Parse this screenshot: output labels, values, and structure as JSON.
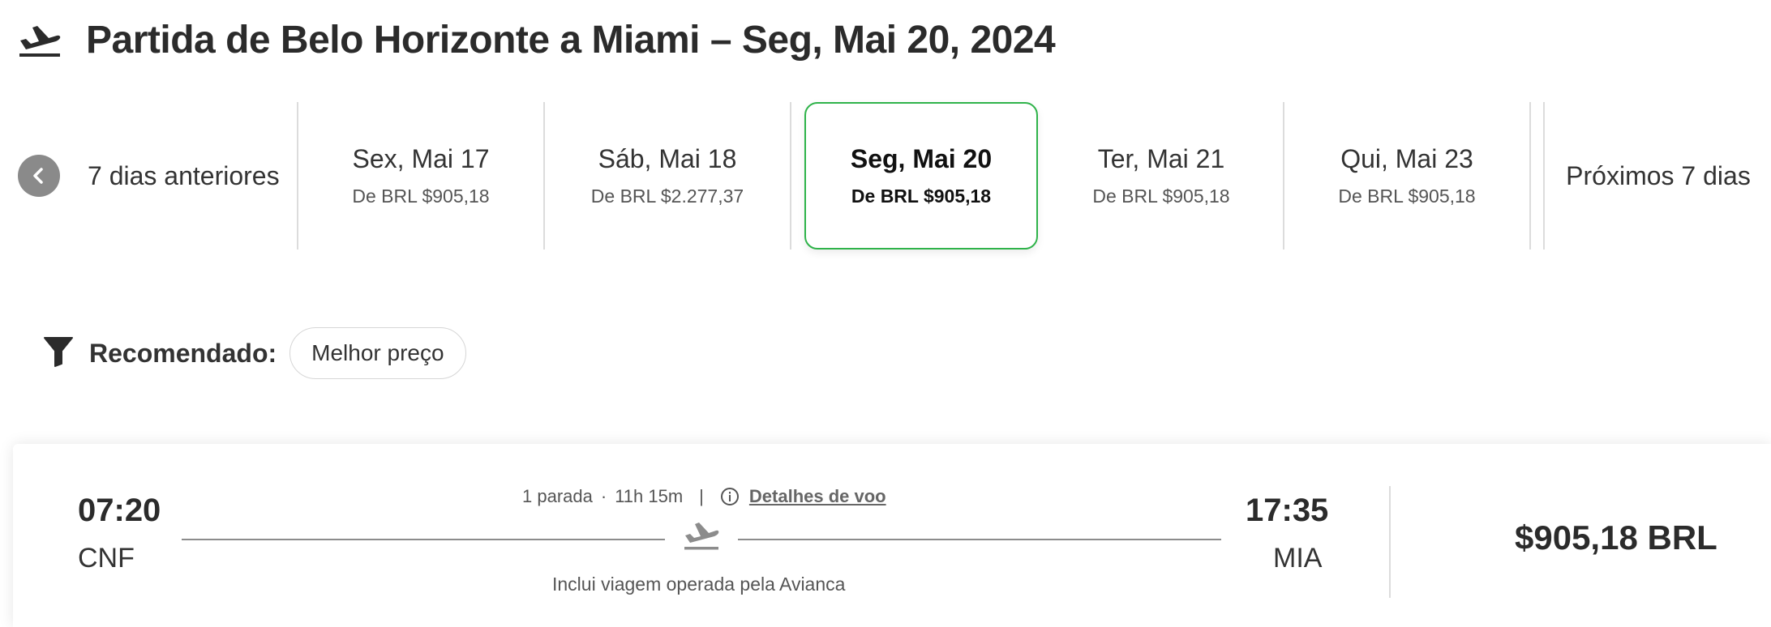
{
  "header": {
    "icon": "airplane-departure-icon",
    "title": "Partida de Belo Horizonte a Miami – Seg, Mai 20, 2024"
  },
  "date_nav": {
    "prev_label": "7 dias anteriores",
    "next_label": "Próximos 7 dias",
    "days": [
      {
        "date": "Sex, Mai 17",
        "price": "De BRL $905,18"
      },
      {
        "date": "Sáb, Mai 18",
        "price": "De BRL $2.277,37"
      },
      {
        "date": "Seg, Mai 20",
        "price": "De BRL $905,18",
        "selected": true
      },
      {
        "date": "Ter, Mai 21",
        "price": "De BRL $905,18"
      },
      {
        "date": "Qui, Mai 23",
        "price": "De BRL $905,18"
      }
    ],
    "selected_color": "#2fb34a"
  },
  "filter": {
    "label": "Recomendado:",
    "chip": "Melhor preço"
  },
  "flight": {
    "departure_time": "07:20",
    "departure_code": "CNF",
    "arrival_time": "17:35",
    "arrival_code": "MIA",
    "stops": "1 parada",
    "separator": "·",
    "duration": "11h 15m",
    "pipe": "|",
    "details_label": "Detalhes de voo",
    "operated_by": "Inclui viagem operada pela Avianca",
    "price": "$905,18 BRL"
  }
}
